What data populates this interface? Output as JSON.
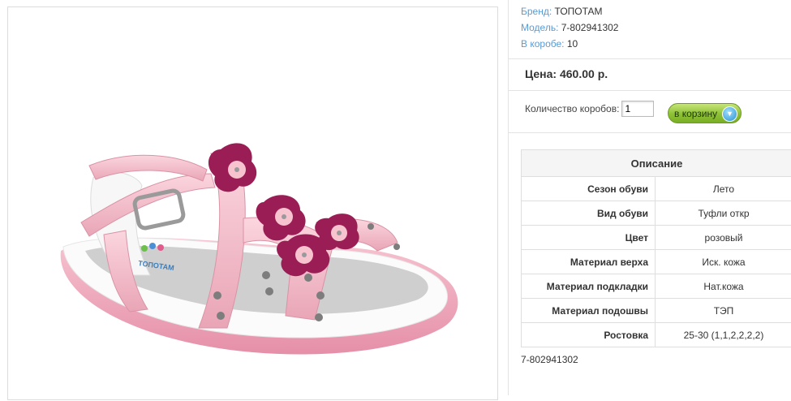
{
  "product": {
    "brand_label": "Бренд:",
    "brand_value": "ТОПОТАМ",
    "model_label": "Модель:",
    "model_value": "7-802941302",
    "box_label": "В коробе:",
    "box_value": "10",
    "price_text": "Цена: 460.00 р.",
    "image_icon": "sandal-product-photo",
    "image_logo_text": "ТОПОТАМ"
  },
  "order": {
    "qty_label": "Количество коробов:",
    "qty_value": "1",
    "cart_button_label": "в корзину",
    "cart_icon": "basket-icon"
  },
  "description": {
    "title": "Описание",
    "rows": [
      {
        "key": "Сезон обуви",
        "value": "Лето"
      },
      {
        "key": "Вид обуви",
        "value": "Туфли откр"
      },
      {
        "key": "Цвет",
        "value": "розовый"
      },
      {
        "key": "Материал верха",
        "value": "Иск. кожа"
      },
      {
        "key": "Материал подкладки",
        "value": "Нат.кожа"
      },
      {
        "key": "Материал подошвы",
        "value": "ТЭП"
      },
      {
        "key": "Ростовка",
        "value": "25-30 (1,1,2,2,2,2)"
      }
    ]
  },
  "footer_code": "7-802941302",
  "colors": {
    "link_label": "#5b9bd5",
    "button_green": "#8dc135",
    "sandal_pink": "#f3b6c6",
    "flower_magenta": "#9b1d55"
  }
}
